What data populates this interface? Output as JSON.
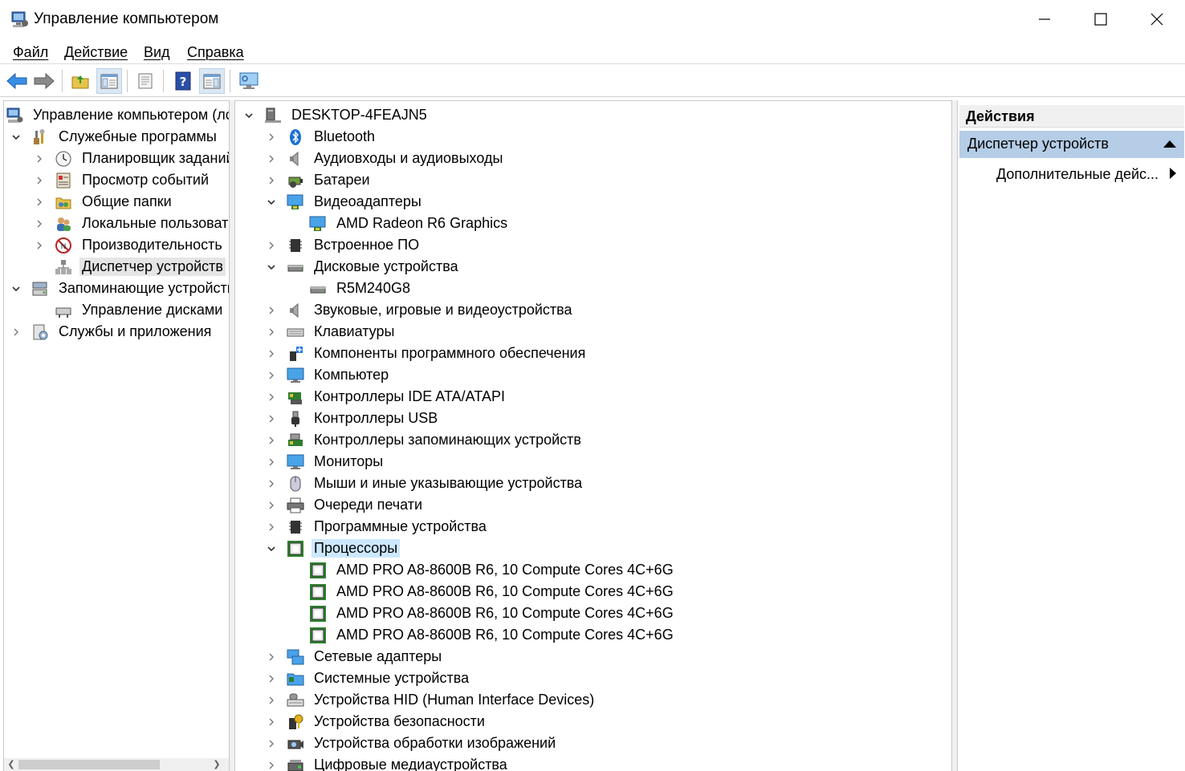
{
  "window": {
    "title": "Управление компьютером"
  },
  "menu": [
    "Файл",
    "Действие",
    "Вид",
    "Справка"
  ],
  "toolbar": [
    "back",
    "forward",
    "up-folder",
    "show-hide-tree",
    "properties",
    "help",
    "show-hide-action-pane",
    "scan-hardware"
  ],
  "left_tree": {
    "root": "Управление компьютером (лс",
    "items": [
      {
        "label": "Служебные программы"
      },
      {
        "label": "Планировщик заданий"
      },
      {
        "label": "Просмотр событий"
      },
      {
        "label": "Общие папки"
      },
      {
        "label": "Локальные пользовате"
      },
      {
        "label": "Производительность"
      },
      {
        "label": "Диспетчер устройств"
      },
      {
        "label": "Запоминающие устройств"
      },
      {
        "label": "Управление дисками"
      },
      {
        "label": "Службы и приложения"
      }
    ]
  },
  "device_tree": {
    "computer": "DESKTOP-4FEAJN5",
    "items": [
      "Bluetooth",
      "Аудиовходы и аудиовыходы",
      "Батареи",
      "Видеоадаптеры",
      "AMD Radeon R6 Graphics",
      "Встроенное ПО",
      "Дисковые устройства",
      "R5M240G8",
      "Звуковые, игровые и видеоустройства",
      "Клавиатуры",
      "Компоненты программного обеспечения",
      "Компьютер",
      "Контроллеры IDE ATA/ATAPI",
      "Контроллеры USB",
      "Контроллеры запоминающих устройств",
      "Мониторы",
      "Мыши и иные указывающие устройства",
      "Очереди печати",
      "Программные устройства",
      "Процессоры",
      "AMD PRO A8-8600B R6, 10 Compute Cores 4C+6G",
      "AMD PRO A8-8600B R6, 10 Compute Cores 4C+6G",
      "AMD PRO A8-8600B R6, 10 Compute Cores 4C+6G",
      "AMD PRO A8-8600B R6, 10 Compute Cores 4C+6G",
      "Сетевые адаптеры",
      "Системные устройства",
      "Устройства HID (Human Interface Devices)",
      "Устройства безопасности",
      "Устройства обработки изображений",
      "Цифровые медиаустройства"
    ]
  },
  "actions": {
    "header": "Действия",
    "section": "Диспетчер устройств",
    "item": "Дополнительные дейс..."
  }
}
